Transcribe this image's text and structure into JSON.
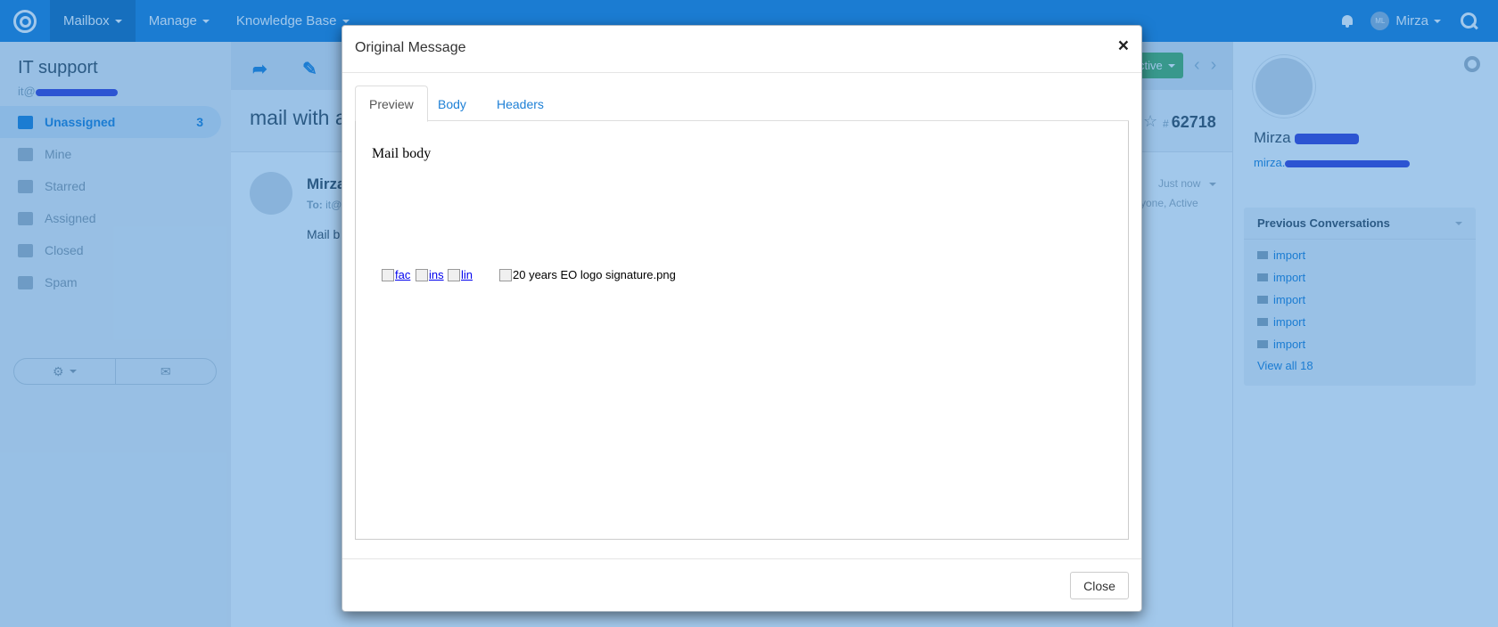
{
  "topnav": {
    "menus": [
      {
        "label": "Mailbox"
      },
      {
        "label": "Manage"
      },
      {
        "label": "Knowledge Base"
      }
    ],
    "user_initials": "ML",
    "user_name": "Mirza"
  },
  "sidebar": {
    "mailbox_name": "IT support",
    "mailbox_email": "it@",
    "folders": [
      {
        "label": "Unassigned",
        "count": "3",
        "icon": "folder-open-icon"
      },
      {
        "label": "Mine",
        "count": "",
        "icon": "hand-icon"
      },
      {
        "label": "Starred",
        "count": "",
        "icon": "star-icon"
      },
      {
        "label": "Assigned",
        "count": "",
        "icon": "user-icon"
      },
      {
        "label": "Closed",
        "count": "",
        "icon": "lock-icon"
      },
      {
        "label": "Spam",
        "count": "",
        "icon": "ban-icon"
      }
    ]
  },
  "conversation": {
    "subject": "mail with a",
    "number": "62718",
    "status": "ctive",
    "from": "Mirza",
    "to_label": "To:",
    "to_value": "it@",
    "body_excerpt": "Mail b",
    "time": "Just now",
    "assignee": "yone, Active"
  },
  "customer": {
    "name": "Mirza",
    "email": "mirza.",
    "previous_title": "Previous Conversations",
    "previous": [
      "import",
      "import",
      "import",
      "import",
      "import"
    ],
    "view_all": "View all 18"
  },
  "modal": {
    "title": "Original Message",
    "close_x": "×",
    "tabs": [
      {
        "label": "Preview"
      },
      {
        "label": "Body"
      },
      {
        "label": "Headers"
      }
    ],
    "mail_body": "Mail body",
    "images": {
      "fac": "fac",
      "ins": "ins",
      "lin": "lin",
      "signature": "20 years EO logo signature.png"
    },
    "close_button": "Close"
  },
  "colors": {
    "brand": "#1e80d6",
    "status_active": "#4faf61",
    "redaction": "#3b3fd6"
  }
}
